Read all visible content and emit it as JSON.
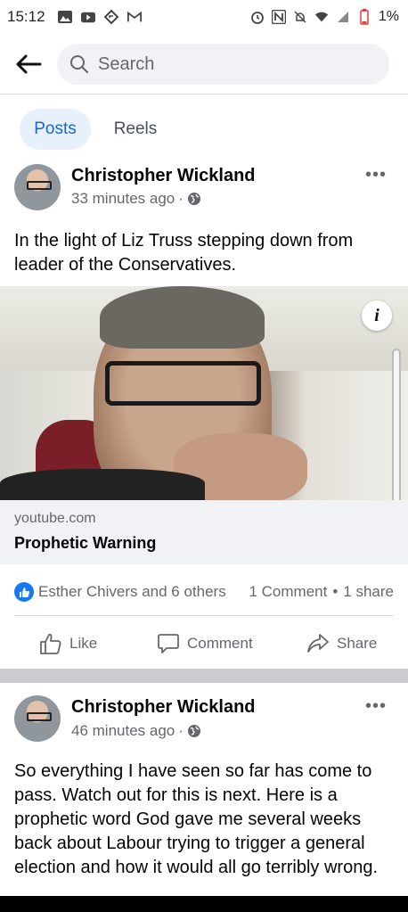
{
  "status_bar": {
    "time": "15:12",
    "battery": "1%",
    "left_icons": [
      "image-icon",
      "youtube-icon",
      "nav-icon",
      "gmail-icon"
    ],
    "right_icons": [
      "alarm-icon",
      "nfc-icon",
      "mute-icon",
      "wifi-icon",
      "signal-icon",
      "battery-icon"
    ]
  },
  "header": {
    "search_placeholder": "Search"
  },
  "tabs": [
    {
      "label": "Posts",
      "active": true
    },
    {
      "label": "Reels",
      "active": false
    }
  ],
  "posts": [
    {
      "author": "Christopher Wickland",
      "time": "33 minutes ago",
      "separator": "·",
      "text": "In the light of Liz Truss stepping down from leader of the Conservatives.",
      "link": {
        "domain": "youtube.com",
        "title": "Prophetic Warning"
      },
      "reactions": {
        "likers": "Esther Chivers and 6 others",
        "comments": "1 Comment",
        "dot": "•",
        "shares": "1 share"
      },
      "actions": {
        "like": "Like",
        "comment": "Comment",
        "share": "Share"
      }
    },
    {
      "author": "Christopher Wickland",
      "time": "46 minutes ago",
      "separator": "·",
      "text": "So everything I have seen so far has come to pass.  Watch out for this is next.  Here is a prophetic word God gave me  several weeks back about Labour trying to trigger a general election and how it would all go terribly wrong."
    }
  ],
  "colors": {
    "accent": "#1877f2",
    "active_tab_bg": "#e7f0fd",
    "active_tab_text": "#1b66d6",
    "secondary_text": "#65676b",
    "divider_band": "#c9ccd1"
  }
}
